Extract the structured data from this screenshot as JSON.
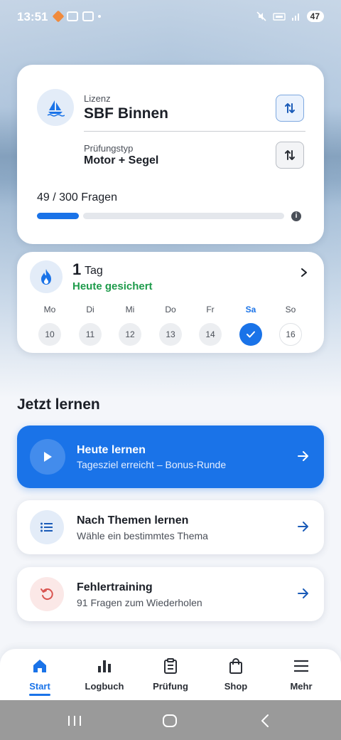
{
  "status_bar": {
    "time": "13:51",
    "battery": "47"
  },
  "license_card": {
    "license_label": "Lizenz",
    "license_value": "SBF Binnen",
    "exam_type_label": "Prüfungstyp",
    "exam_type_value": "Motor + Segel",
    "progress_text": "49 / 300 Fragen",
    "progress_done": 49,
    "progress_total": 300
  },
  "streak": {
    "count": "1",
    "unit": "Tag",
    "status": "Heute gesichert",
    "weekdays": [
      "Mo",
      "Di",
      "Mi",
      "Do",
      "Fr",
      "Sa",
      "So"
    ],
    "dates": [
      "10",
      "11",
      "12",
      "13",
      "14",
      "",
      "16"
    ]
  },
  "section_title": "Jetzt lernen",
  "actions": {
    "today": {
      "title": "Heute lernen",
      "subtitle": "Tagesziel erreicht – Bonus-Runde"
    },
    "topics": {
      "title": "Nach Themen lernen",
      "subtitle": "Wähle ein bestimmtes Thema"
    },
    "mistakes": {
      "title": "Fehlertraining",
      "subtitle": "91 Fragen zum Wiederholen"
    }
  },
  "nav": {
    "start": "Start",
    "logbuch": "Logbuch",
    "pruefung": "Prüfung",
    "shop": "Shop",
    "mehr": "Mehr"
  },
  "colors": {
    "accent": "#1a73e8",
    "success": "#1e9b4b",
    "error": "#d9534f"
  }
}
